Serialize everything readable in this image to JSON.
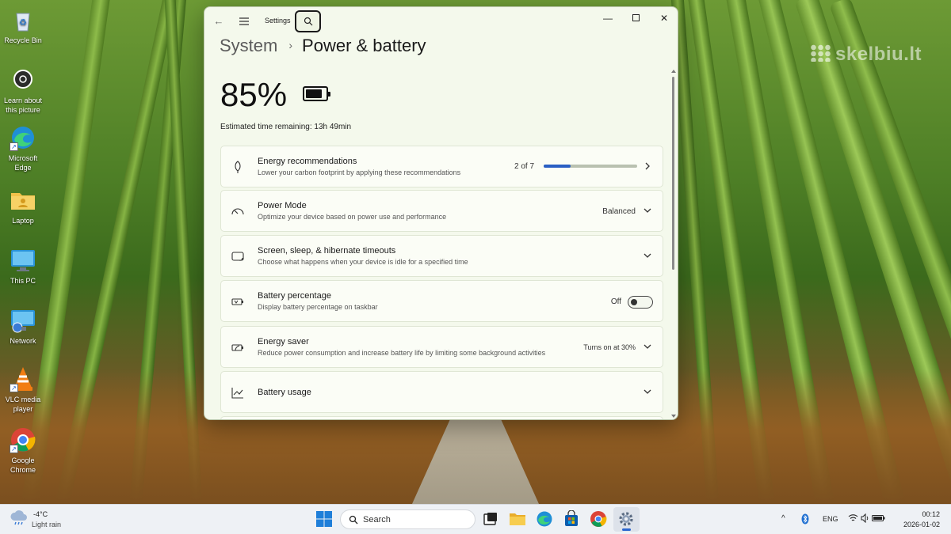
{
  "desktop": {
    "watermark": "skelbiu.lt",
    "icons": [
      {
        "label": "Recycle Bin",
        "icon": "recycle-bin-icon"
      },
      {
        "label": "Learn about this picture",
        "icon": "camera-icon"
      },
      {
        "label": "Microsoft Edge",
        "icon": "edge-icon"
      },
      {
        "label": "Laptop",
        "icon": "folder-icon"
      },
      {
        "label": "This PC",
        "icon": "monitor-icon"
      },
      {
        "label": "Network",
        "icon": "network-icon"
      },
      {
        "label": "VLC media player",
        "icon": "vlc-icon"
      },
      {
        "label": "Google Chrome",
        "icon": "chrome-icon"
      }
    ]
  },
  "window": {
    "app_title": "Settings",
    "breadcrumb": {
      "parent": "System",
      "separator": "›",
      "current": "Power & battery"
    },
    "battery": {
      "percent": "85%",
      "level": 0.85,
      "estimate": "Estimated time remaining: 13h 49min"
    },
    "cards": {
      "energy_recommendations": {
        "title": "Energy recommendations",
        "desc": "Lower your carbon footprint by applying these recommendations",
        "count": "2 of 7",
        "progress": 0.2857,
        "icon": "leaf-icon"
      },
      "power_mode": {
        "title": "Power Mode",
        "desc": "Optimize your device based on power use and performance",
        "value": "Balanced",
        "icon": "gauge-icon"
      },
      "screen_sleep": {
        "title": "Screen, sleep, & hibernate timeouts",
        "desc": "Choose what happens when your device is idle for a specified time",
        "icon": "screen-sleep-icon"
      },
      "battery_percentage": {
        "title": "Battery percentage",
        "desc": "Display battery percentage on taskbar",
        "value": "Off",
        "toggle_on": false,
        "icon": "battery-percent-icon"
      },
      "energy_saver": {
        "title": "Energy saver",
        "desc": "Reduce power consumption and increase battery life by limiting some background activities",
        "value": "Turns on at 30%",
        "icon": "energy-saver-icon"
      },
      "battery_usage": {
        "title": "Battery usage",
        "icon": "chart-icon"
      }
    }
  },
  "taskbar": {
    "weather": {
      "temp": "-4°C",
      "condition": "Light rain"
    },
    "search_placeholder": "Search",
    "apps": [
      "start",
      "search",
      "task-view",
      "file-explorer",
      "edge",
      "store",
      "chrome",
      "settings"
    ],
    "active_app": "settings",
    "tray": {
      "language": "ENG"
    },
    "clock": {
      "time": "00:12",
      "date": "2026-01-02"
    }
  },
  "colors": {
    "accent": "#2a5fc4",
    "window_bg": "#f4f9ec"
  }
}
